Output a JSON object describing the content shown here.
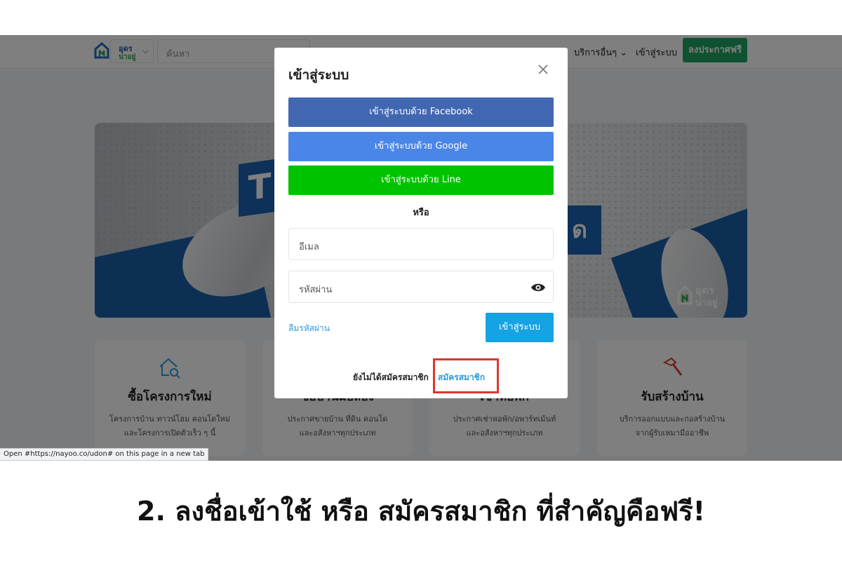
{
  "header": {
    "city_line1": "อุดร",
    "city_line2": "น่าอยู่",
    "search_placeholder": "ค้นหา",
    "nav_services": "บริการอื่นๆ",
    "nav_login": "เข้าสู่ระบบ",
    "post_free": "ลงประกาศฟรี"
  },
  "banner": {
    "cube_left": "T",
    "cube_right": "ด",
    "logo_line1": "อุดร",
    "logo_line2": "น่าอยู่"
  },
  "cards": [
    {
      "title": "ซื้อโครงการใหม่",
      "desc1": "โครงการบ้าน ทาวน์โฮม คอนโดใหม่",
      "desc2": "และโครงการเปิดตัวเร็ว ๆ นี้"
    },
    {
      "title": "ซื้อบ้านมือสอง",
      "desc1": "ประกาศขายบ้าน ที่ดิน คอนโด",
      "desc2": "และอสังหาฯทุกประเภท"
    },
    {
      "title": "เช่าหอพัก",
      "desc1": "ประกาศเช่าหอพัก/อพาร์ทเม้นท์",
      "desc2": "และอสังหาฯทุกประเภท"
    },
    {
      "title": "รับสร้างบ้าน",
      "desc1": "บริการออกแบบและก่อสร้างบ้าน",
      "desc2": "จากผู้รับเหมามืออาชีพ"
    }
  ],
  "modal": {
    "title": "เข้าสู่ระบบ",
    "facebook_btn": "เข้าสู่ระบบด้วย Facebook",
    "google_btn": "เข้าสู่ระบบด้วย Google",
    "line_btn": "เข้าสู่ระบบด้วย Line",
    "or_text": "หรือ",
    "email_placeholder": "อีเมล",
    "password_placeholder": "รหัสผ่าน",
    "forgot": "ลืมรหัสผ่าน",
    "login_btn": "เข้าสู่ระบบ",
    "not_member": "ยังไม่ได้สมัครสมาชิก",
    "signup_link": "สมัครสมาชิก"
  },
  "colors": {
    "facebook": "#4267b2",
    "google": "#4a86e8",
    "line": "#00c300",
    "accent": "#15a3e3",
    "highlight": "#e0362d",
    "post_button": "#1fa463"
  },
  "status_bar": "Open #https://nayoo.co/udon# on this page in a new tab",
  "caption": "2. ลงชื่อเข้าใช้ หรือ สมัครสมาชิก ที่สำคัญคือฟรี!"
}
